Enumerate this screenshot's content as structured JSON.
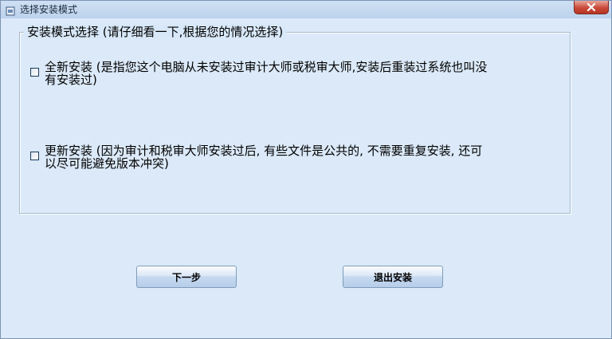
{
  "window": {
    "title": "选择安装模式",
    "close_icon": "close-icon",
    "app_icon": "installer-app-icon"
  },
  "group": {
    "legend": "安装模式选择 (请仔细看一下,根据您的情况选择)"
  },
  "options": [
    {
      "line1": "全新安装 (是指您这个电脑从未安装过审计大师或税审大师,安装后重装过系统也叫没",
      "line2": "有安装过)",
      "checked": false
    },
    {
      "line1": "更新安装 (因为审计和税审大师安装过后, 有些文件是公共的, 不需要重复安装, 还可",
      "line2": "以尽可能避免版本冲突)",
      "checked": false
    }
  ],
  "buttons": {
    "next": "下一步",
    "exit": "退出安装"
  }
}
